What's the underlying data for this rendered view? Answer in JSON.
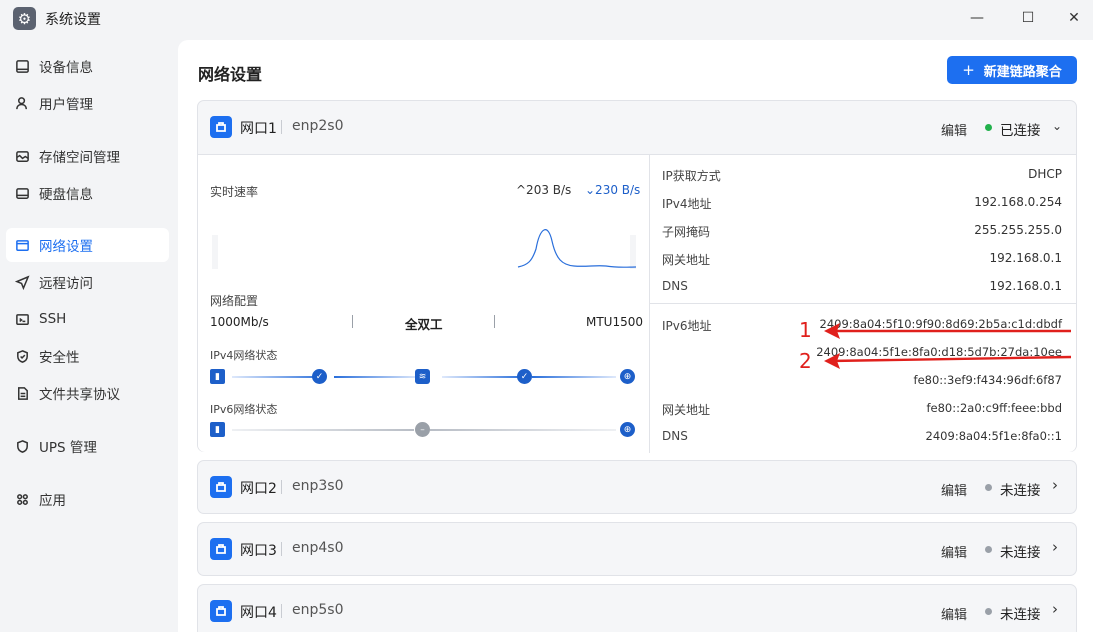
{
  "window": {
    "title": "系统设置",
    "app_icon": "gear-icon",
    "min": "—",
    "max": "☐",
    "close": "✕"
  },
  "sidebar": {
    "items": [
      {
        "label": "设备信息",
        "icon": "monitor-icon"
      },
      {
        "label": "用户管理",
        "icon": "user-icon"
      },
      {
        "label": "存储空间管理",
        "icon": "storage-icon"
      },
      {
        "label": "硬盘信息",
        "icon": "disk-icon"
      },
      {
        "label": "网络设置",
        "icon": "network-icon",
        "active": true
      },
      {
        "label": "远程访问",
        "icon": "send-icon"
      },
      {
        "label": "SSH",
        "icon": "terminal-icon"
      },
      {
        "label": "安全性",
        "icon": "shield-icon"
      },
      {
        "label": "文件共享协议",
        "icon": "file-icon"
      },
      {
        "label": "UPS 管理",
        "icon": "ups-shield-icon"
      },
      {
        "label": "应用",
        "icon": "apps-icon"
      }
    ]
  },
  "main": {
    "title": "网络设置",
    "new_button": "新建链路聚合",
    "new_button_icon": "+",
    "ports": [
      {
        "name": "网口1",
        "iface": "enp2s0",
        "edit": "编辑",
        "status": "已连接",
        "status_color": "#22b14c",
        "chevron": "⌄"
      },
      {
        "name": "网口2",
        "iface": "enp3s0",
        "edit": "编辑",
        "status": "未连接",
        "status_color": "#9aa0a8",
        "chevron": "›"
      },
      {
        "name": "网口3",
        "iface": "enp4s0",
        "edit": "编辑",
        "status": "未连接",
        "status_color": "#9aa0a8",
        "chevron": "›"
      },
      {
        "name": "网口4",
        "iface": "enp5s0",
        "edit": "编辑",
        "status": "未连接",
        "status_color": "#9aa0a8",
        "chevron": "›"
      }
    ],
    "detail": {
      "speed_label": "实时速率",
      "upload": "^203 B/s",
      "download": "⌄230 B/s",
      "config_label": "网络配置",
      "link_speed": "1000Mb/s",
      "duplex": "全双工",
      "mtu": "MTU1500",
      "ipv4_state_label": "IPv4网络状态",
      "ipv6_state_label": "IPv6网络状态",
      "ipv4": [
        {
          "label": "IP获取方式",
          "value": "DHCP"
        },
        {
          "label": "IPv4地址",
          "value": "192.168.0.254"
        },
        {
          "label": "子网掩码",
          "value": "255.255.255.0"
        },
        {
          "label": "网关地址",
          "value": "192.168.0.1"
        },
        {
          "label": "DNS",
          "value": "192.168.0.1"
        }
      ],
      "ipv6_label": "IPv6地址",
      "ipv6_addresses": [
        "2409:8a04:5f10:9f90:8d69:2b5a:c1d:dbdf",
        "2409:8a04:5f1e:8fa0:d18:5d7b:27da:10ee",
        "fe80::3ef9:f434:96df:6f87"
      ],
      "ipv6_gateway_label": "网关地址",
      "ipv6_gateway": "fe80::2a0:c9ff:feee:bbd",
      "ipv6_dns_label": "DNS",
      "ipv6_dns": "2409:8a04:5f1e:8fa0::1"
    },
    "annotations": [
      "1",
      "2"
    ]
  }
}
